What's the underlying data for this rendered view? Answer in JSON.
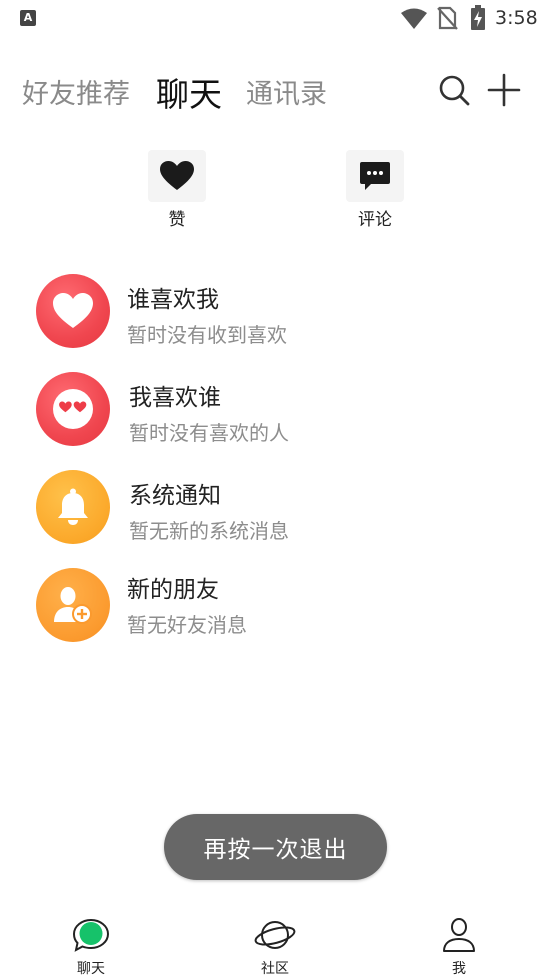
{
  "status_bar": {
    "time": "3:58",
    "app_badge": "A"
  },
  "top_tabs": [
    {
      "label": "好友推荐",
      "active": false
    },
    {
      "label": "聊天",
      "active": true
    },
    {
      "label": "通讯录",
      "active": false
    }
  ],
  "top_actions": {
    "search_icon": "search-icon",
    "plus_icon": "plus-icon"
  },
  "quick_actions": {
    "like_label": "赞",
    "comment_label": "评论"
  },
  "messages": [
    {
      "title": "谁喜欢我",
      "subtitle": "暂时没有收到喜欢",
      "icon": "heart-icon",
      "color": "#f0464f"
    },
    {
      "title": "我喜欢谁",
      "subtitle": "暂时没有喜欢的人",
      "icon": "heart-eyes-face-icon",
      "color": "#f0464f"
    },
    {
      "title": "系统通知",
      "subtitle": "暂无新的系统消息",
      "icon": "bell-icon",
      "color": "#fba82a"
    },
    {
      "title": "新的朋友",
      "subtitle": "暂无好友消息",
      "icon": "add-friend-icon",
      "color": "#fb9a2e"
    }
  ],
  "toast": {
    "text": "再按一次退出"
  },
  "bottom_nav": [
    {
      "label": "聊天",
      "active": true
    },
    {
      "label": "社区",
      "active": false
    },
    {
      "label": "我",
      "active": false
    }
  ],
  "colors": {
    "accent_green": "#1ec06a",
    "text_primary": "#222222",
    "text_secondary": "#8d8d8d"
  }
}
